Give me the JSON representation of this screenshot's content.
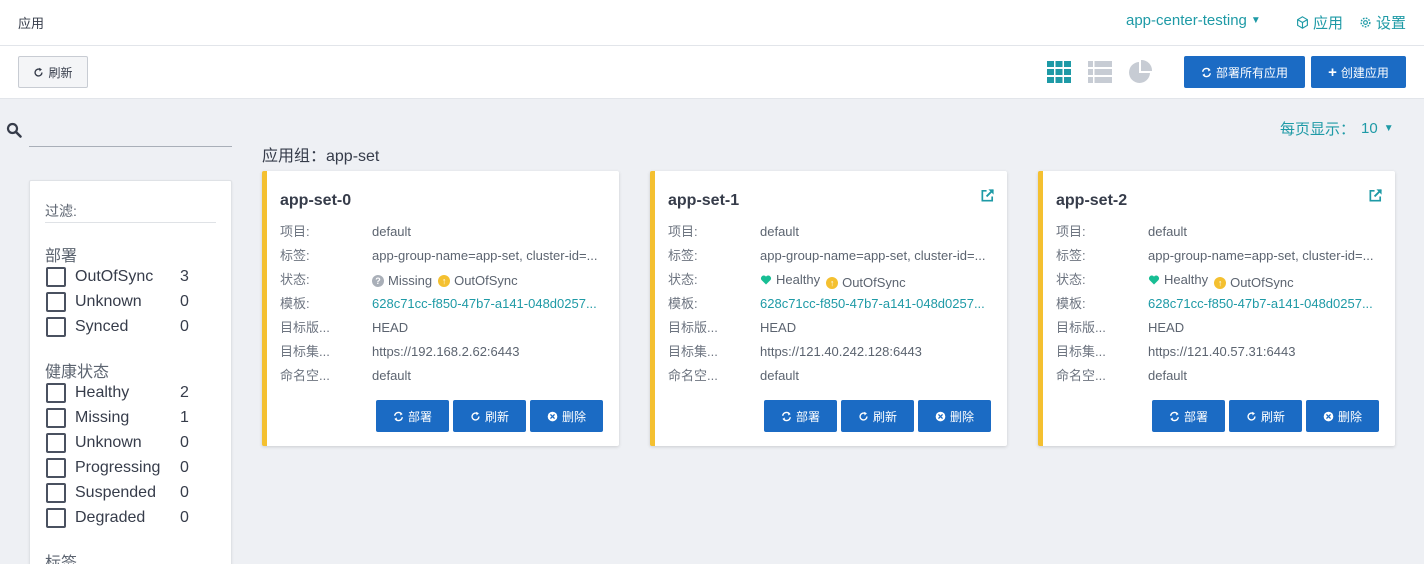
{
  "header": {
    "page_title": "应用",
    "context": "app-center-testing",
    "nav_apps": "应用",
    "nav_settings": "设置"
  },
  "toolbar": {
    "refresh": "刷新",
    "sync_all": "部署所有应用",
    "create_app": "创建应用",
    "view_modes": [
      "tiles-icon",
      "list-icon",
      "pie-chart-icon"
    ],
    "active_view": "tiles"
  },
  "search": {
    "value": "",
    "placeholder": ""
  },
  "pagination": {
    "label": "每页显示：",
    "value": "10"
  },
  "group_title": "应用组：app-set",
  "filter": {
    "title": "过滤:",
    "sync_title": "部署",
    "sync_items": [
      {
        "label": "OutOfSync",
        "count": "3"
      },
      {
        "label": "Unknown",
        "count": "0"
      },
      {
        "label": "Synced",
        "count": "0"
      }
    ],
    "health_title": "健康状态",
    "health_items": [
      {
        "label": "Healthy",
        "count": "2"
      },
      {
        "label": "Missing",
        "count": "1"
      },
      {
        "label": "Unknown",
        "count": "0"
      },
      {
        "label": "Progressing",
        "count": "0"
      },
      {
        "label": "Suspended",
        "count": "0"
      },
      {
        "label": "Degraded",
        "count": "0"
      }
    ],
    "labels_title": "标签"
  },
  "card_labels": {
    "project": "项目:",
    "labels": "标签:",
    "status": "状态:",
    "template": "模板:",
    "target_revision": "目标版...",
    "target_cluster": "目标集...",
    "namespace": "命名空...",
    "sync": "部署",
    "refresh": "刷新",
    "delete": "删除"
  },
  "colors": {
    "accent": "#1e9aa6",
    "primary": "#1b6bc4",
    "card_border": "#f4c030",
    "healthy": "#18be94",
    "outofsync": "#f4c030",
    "missing": "#a9afb8"
  },
  "apps": [
    {
      "name": "app-set-0",
      "project": "default",
      "labels": "app-group-name=app-set, cluster-id=...",
      "health": "Missing",
      "sync": "OutOfSync",
      "template": "628c71cc-f850-47b7-a141-048d0257...",
      "target_revision": "HEAD",
      "target_cluster": "https://192.168.2.62:6443",
      "namespace": "default",
      "show_external_link": false
    },
    {
      "name": "app-set-1",
      "project": "default",
      "labels": "app-group-name=app-set, cluster-id=...",
      "health": "Healthy",
      "sync": "OutOfSync",
      "template": "628c71cc-f850-47b7-a141-048d0257...",
      "target_revision": "HEAD",
      "target_cluster": "https://121.40.242.128:6443",
      "namespace": "default",
      "show_external_link": true
    },
    {
      "name": "app-set-2",
      "project": "default",
      "labels": "app-group-name=app-set, cluster-id=...",
      "health": "Healthy",
      "sync": "OutOfSync",
      "template": "628c71cc-f850-47b7-a141-048d0257...",
      "target_revision": "HEAD",
      "target_cluster": "https://121.40.57.31:6443",
      "namespace": "default",
      "show_external_link": true
    }
  ]
}
